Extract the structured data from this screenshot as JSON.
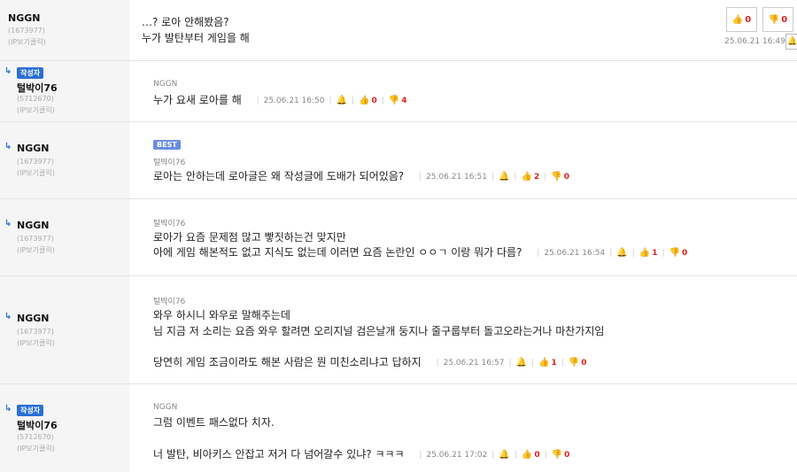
{
  "comments": [
    {
      "nick": "NGGN",
      "uid": "(1673977)",
      "ip": "(IP보기클릭)",
      "lines": [
        "…? 로아 안해봤음?",
        "누가 발탄부터 게임을 해"
      ],
      "date": "25.06.21 16:49",
      "up": "0",
      "down": "0"
    },
    {
      "badge": "작성자",
      "nick": "털박이76",
      "uid": "(5712670)",
      "ip": "(IP보기클릭)",
      "ref": "NGGN",
      "lines": [
        "누가 요새 로아를 해"
      ],
      "date": "25.06.21 16:50",
      "up": "0",
      "down": "4"
    },
    {
      "nick": "NGGN",
      "uid": "(1673977)",
      "ip": "(IP보기클릭)",
      "best": "BEST",
      "ref": "털박이76",
      "lines": [
        "로아는 안하는데 로아글은 왜 작성글에 도배가 되어있음?"
      ],
      "date": "25.06.21 16:51",
      "up": "2",
      "down": "0"
    },
    {
      "nick": "NGGN",
      "uid": "(1673977)",
      "ip": "(IP보기클릭)",
      "ref": "털박이76",
      "lines": [
        "로아가 요즘 문제점 많고 빻짓하는건 맞지만",
        "아에 게임 해본적도 없고 지식도 없는데 이러면 요즘 논란인 ㅇㅇㄱ 이랑 뭐가 다름?"
      ],
      "date": "25.06.21 16:54",
      "up": "1",
      "down": "0"
    },
    {
      "nick": "NGGN",
      "uid": "(1673977)",
      "ip": "(IP보기클릭)",
      "ref": "털박이76",
      "lines": [
        "와우 하시니 와우로 말해주는데",
        "님 지금 저 소리는 요즘 와우 할려면 오리지널 검은날개 둥지나 줄구룹부터 돌고오라는거나 마찬가지임",
        "",
        "당연히 게임 조금이라도 해본 사람은 뭔 미친소리냐고 답하지"
      ],
      "date": "25.06.21 16:57",
      "up": "1",
      "down": "0"
    },
    {
      "badge": "작성자",
      "nick": "털박이76",
      "uid": "(5712670)",
      "ip": "(IP보기클릭)",
      "ref": "NGGN",
      "lines": [
        "그럼 이벤트 패스없다 치자.",
        "",
        "너 발탄, 비아키스 안잡고 저거 다 넘어갈수 있냐? ㅋㅋㅋ"
      ],
      "date": "25.06.21 17:02",
      "up": "0",
      "down": "0"
    }
  ]
}
